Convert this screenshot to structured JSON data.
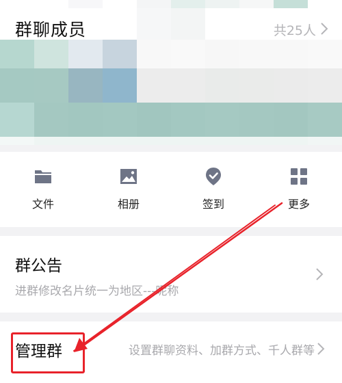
{
  "members": {
    "title": "群聊成员",
    "count": "共25人"
  },
  "tools": [
    {
      "label": "文件",
      "icon": "folder-icon"
    },
    {
      "label": "相册",
      "icon": "image-icon"
    },
    {
      "label": "签到",
      "icon": "check-badge-icon"
    },
    {
      "label": "更多",
      "icon": "grid-icon"
    }
  ],
  "announcement": {
    "title": "群公告",
    "text": "进群修改名片统一为地区---昵称"
  },
  "manage": {
    "title": "管理群",
    "description": "设置群聊资料、加群方式、千人群等"
  },
  "colors": {
    "icon": "#6e7486",
    "annotation": "#e8222a"
  }
}
